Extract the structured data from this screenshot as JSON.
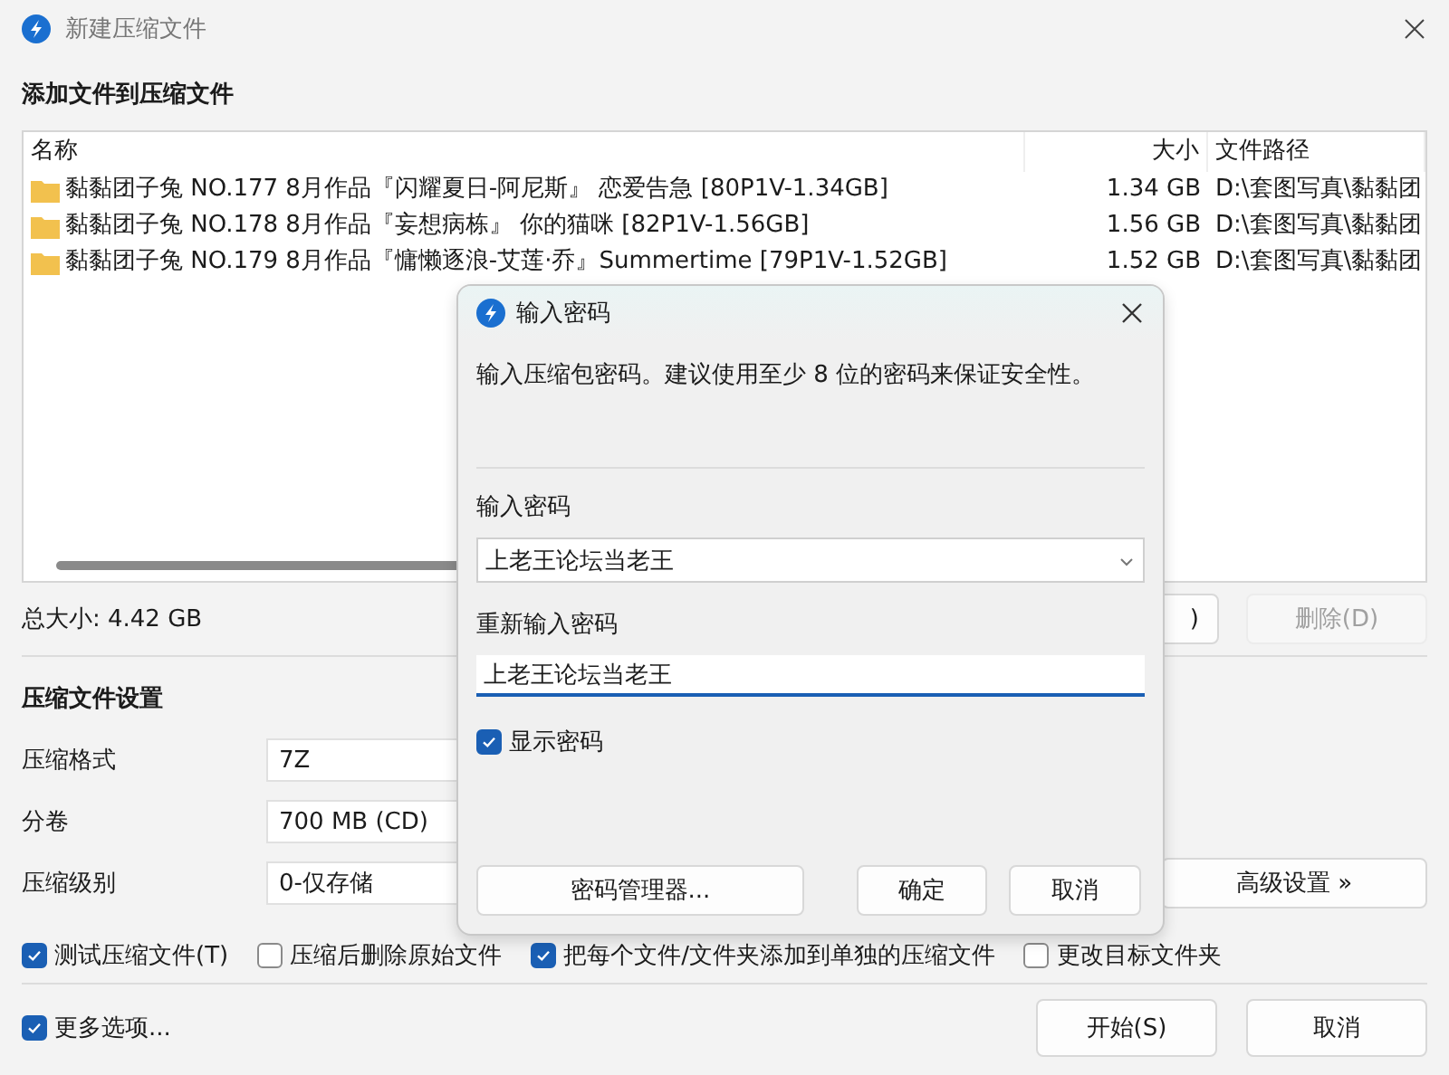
{
  "window": {
    "title": "新建压缩文件"
  },
  "files": {
    "heading": "添加文件到压缩文件",
    "columns": [
      "名称",
      "大小",
      "文件路径"
    ],
    "rows": [
      {
        "name": "黏黏团子兔 NO.177 8月作品『闪耀夏日-阿尼斯』 恋爱告急 [80P1V-1.34GB]",
        "size": "1.34 GB",
        "path": "D:\\套图写真\\黏黏团"
      },
      {
        "name": "黏黏团子兔 NO.178 8月作品『妄想病栋』 你的猫咪 [82P1V-1.56GB]",
        "size": "1.56 GB",
        "path": "D:\\套图写真\\黏黏团"
      },
      {
        "name": "黏黏团子兔 NO.179 8月作品『慵懒逐浪-艾莲·乔』Summertime [79P1V-1.52GB]",
        "size": "1.52 GB",
        "path": "D:\\套图写真\\黏黏团"
      }
    ],
    "total_size": "总大小: 4.42 GB",
    "buttons": [
      {
        "label": ")",
        "disabled": false
      },
      {
        "label": "删除(D)",
        "disabled": true
      }
    ]
  },
  "settings": {
    "heading": "压缩文件设置",
    "fields": [
      {
        "label": "压缩格式",
        "value": "7Z"
      },
      {
        "label": "分卷",
        "value": "700 MB (CD)"
      },
      {
        "label": "压缩级别",
        "value": "0-仅存储"
      }
    ],
    "advanced_button": "高级设置 »",
    "options": [
      {
        "label": "测试压缩文件(T)",
        "checked": true
      },
      {
        "label": "压缩后删除原始文件",
        "checked": false
      },
      {
        "label": "把每个文件/文件夹添加到单独的压缩文件",
        "checked": true
      },
      {
        "label": "更改目标文件夹",
        "checked": false
      }
    ]
  },
  "more_options": {
    "label": "更多选项...",
    "checked": true
  },
  "footer_buttons": [
    "开始(S)",
    "取消"
  ],
  "dialog": {
    "title": "输入密码",
    "message": "输入压缩包密码。建议使用至少 8 位的密码来保证安全性。",
    "password_label": "输入密码",
    "password_value": "上老王论坛当老王",
    "confirm_label": "重新输入密码",
    "confirm_value": "上老王论坛当老王",
    "show_password": {
      "label": "显示密码",
      "checked": true
    },
    "buttons": [
      "密码管理器...",
      "确定",
      "取消"
    ]
  }
}
